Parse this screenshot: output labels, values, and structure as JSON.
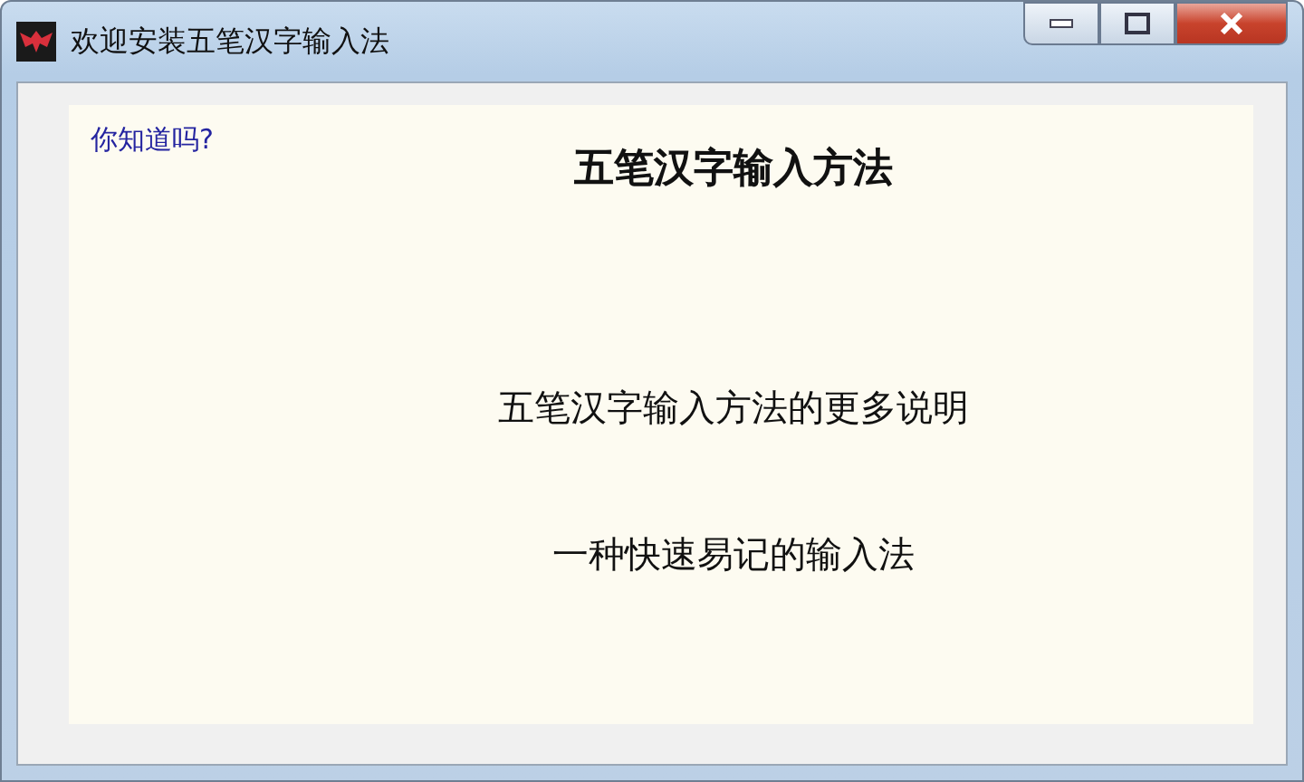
{
  "window": {
    "title": "欢迎安装五笔汉字输入法"
  },
  "panel": {
    "hint": "你知道吗?",
    "heading": "五笔汉字输入方法",
    "lines": [
      "五笔汉字输入方法的更多说明",
      "一种快速易记的输入法"
    ]
  }
}
